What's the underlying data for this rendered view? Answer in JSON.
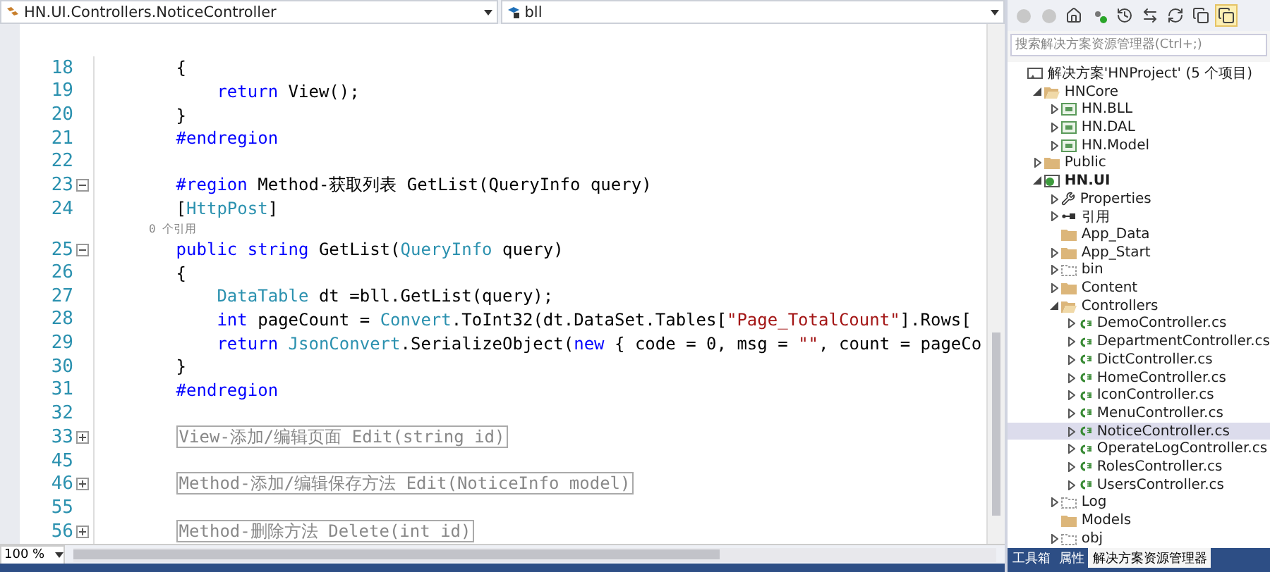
{
  "editor": {
    "type_dropdown": "HN.UI.Controllers.NoticeController",
    "member_dropdown": "bll",
    "lines": [
      {
        "kind": "line",
        "number": "18",
        "tokens": [
          {
            "kind": "plain",
            "text": "{"
          }
        ],
        "children": [
          {
            "kind": "line",
            "number": "19",
            "tokens": [
              {
                "kind": "keyword",
                "text": "return"
              },
              {
                "kind": "plain",
                "text": " View();"
              }
            ]
          }
        ]
      },
      {
        "kind": "line",
        "number": "20",
        "tokens": [
          {
            "kind": "plain",
            "text": "}"
          }
        ]
      },
      {
        "kind": "line",
        "number": "21",
        "tokens": [
          {
            "kind": "keyword",
            "text": "#endregion"
          }
        ]
      },
      {
        "kind": "line",
        "number": "22"
      },
      {
        "kind": "fold-open",
        "number": "23",
        "tokens": [
          {
            "kind": "keyword",
            "text": "#region"
          },
          {
            "kind": "plain",
            "text": " Method-获取列表 GetList(QueryInfo query)"
          }
        ]
      },
      {
        "kind": "line",
        "number": "24",
        "tokens": [
          {
            "kind": "plain",
            "text": "["
          },
          {
            "kind": "type",
            "text": "HttpPost"
          },
          {
            "kind": "plain",
            "text": "]"
          }
        ]
      },
      {
        "kind": "lens",
        "text": "0 个引用"
      },
      {
        "kind": "fold-open",
        "number": "25",
        "tokens": [
          {
            "kind": "keyword",
            "text": "public string"
          },
          {
            "kind": "plain",
            "text": " GetList("
          },
          {
            "kind": "type",
            "text": "QueryInfo"
          },
          {
            "kind": "plain",
            "text": " query)"
          }
        ]
      },
      {
        "kind": "line",
        "number": "26",
        "tokens": [
          {
            "kind": "plain",
            "text": "{"
          }
        ],
        "children": [
          {
            "kind": "line",
            "number": "27",
            "tokens": [
              {
                "kind": "type",
                "text": "DataTable"
              },
              {
                "kind": "plain",
                "text": " dt =bll.GetList(query);"
              }
            ]
          },
          {
            "kind": "line",
            "number": "28",
            "tokens": [
              {
                "kind": "keyword",
                "text": "int"
              },
              {
                "kind": "plain",
                "text": " pageCount = "
              },
              {
                "kind": "type",
                "text": "Convert"
              },
              {
                "kind": "plain",
                "text": ".ToInt32(dt.DataSet.Tables["
              },
              {
                "kind": "string",
                "text": "\"Page_TotalCount\""
              },
              {
                "kind": "plain",
                "text": "].Rows["
              }
            ]
          },
          {
            "kind": "line",
            "number": "29",
            "tokens": [
              {
                "kind": "keyword",
                "text": "return"
              },
              {
                "kind": "type",
                "text": " JsonConvert"
              },
              {
                "kind": "plain",
                "text": ".SerializeObject("
              },
              {
                "kind": "keyword",
                "text": "new"
              },
              {
                "kind": "plain",
                "text": " { code = 0, msg = "
              },
              {
                "kind": "string",
                "text": "\"\""
              },
              {
                "kind": "plain",
                "text": ", count = pageCo"
              }
            ]
          }
        ]
      },
      {
        "kind": "line",
        "number": "30",
        "tokens": [
          {
            "kind": "plain",
            "text": "}"
          }
        ]
      },
      {
        "kind": "line",
        "number": "31",
        "tokens": [
          {
            "kind": "keyword",
            "text": "#endregion"
          }
        ]
      },
      {
        "kind": "line",
        "number": "32"
      },
      {
        "kind": "fold-closed",
        "number": "33",
        "tokens": [
          {
            "kind": "collapsed",
            "text": "View-添加/编辑页面 Edit(string id)"
          }
        ]
      },
      {
        "kind": "line",
        "number": "45"
      },
      {
        "kind": "fold-closed",
        "number": "46",
        "tokens": [
          {
            "kind": "collapsed",
            "text": "Method-添加/编辑保存方法 Edit(NoticeInfo model)"
          }
        ]
      },
      {
        "kind": "line",
        "number": "55"
      },
      {
        "kind": "fold-closed",
        "number": "56",
        "tokens": [
          {
            "kind": "collapsed",
            "text": "Method-删除方法 Delete(int id)"
          }
        ]
      }
    ],
    "zoom": "100 %"
  },
  "solution_explorer": {
    "search": {
      "placeholder": "搜索解决方案资源管理器(Ctrl+;)"
    },
    "tree": [
      {
        "label": "解决方案'HNProject' (5 个项目)",
        "kind": "solution",
        "selected": false,
        "children": [
          {
            "label": "HNCore",
            "kind": "folder",
            "expanded": true,
            "selected": false,
            "children": [
              {
                "label": "HN.BLL",
                "kind": "library",
                "expanded": false,
                "selected": false
              },
              {
                "label": "HN.DAL",
                "kind": "library",
                "expanded": false,
                "selected": false
              },
              {
                "label": "HN.Model",
                "kind": "library",
                "expanded": false,
                "selected": false
              }
            ]
          },
          {
            "label": "Public",
            "kind": "folder",
            "expanded": false,
            "selected": false
          },
          {
            "label": "HN.UI",
            "kind": "webproject",
            "expanded": true,
            "selected": false,
            "children": [
              {
                "label": "Properties",
                "kind": "properties",
                "expanded": false,
                "selected": false
              },
              {
                "label": "引用",
                "kind": "references",
                "expanded": false,
                "selected": false
              },
              {
                "label": "App_Data",
                "kind": "folder",
                "selected": false
              },
              {
                "label": "App_Start",
                "kind": "folder",
                "expanded": false,
                "selected": false
              },
              {
                "label": "bin",
                "kind": "hidden-folder",
                "expanded": false,
                "selected": false
              },
              {
                "label": "Content",
                "kind": "folder",
                "expanded": false,
                "selected": false
              },
              {
                "label": "Controllers",
                "kind": "folder",
                "expanded": true,
                "selected": false,
                "children": [
                  {
                    "label": "DemoController.cs",
                    "kind": "csharp",
                    "expanded": false,
                    "selected": false
                  },
                  {
                    "label": "DepartmentController.cs",
                    "kind": "csharp",
                    "expanded": false,
                    "selected": false
                  },
                  {
                    "label": "DictController.cs",
                    "kind": "csharp",
                    "expanded": false,
                    "selected": false
                  },
                  {
                    "label": "HomeController.cs",
                    "kind": "csharp",
                    "expanded": false,
                    "selected": false
                  },
                  {
                    "label": "IconController.cs",
                    "kind": "csharp",
                    "expanded": false,
                    "selected": false
                  },
                  {
                    "label": "MenuController.cs",
                    "kind": "csharp",
                    "expanded": false,
                    "selected": false
                  },
                  {
                    "label": "NoticeController.cs",
                    "kind": "csharp",
                    "expanded": false,
                    "selected": true
                  },
                  {
                    "label": "OperateLogController.cs",
                    "kind": "csharp",
                    "expanded": false,
                    "selected": false
                  },
                  {
                    "label": "RolesController.cs",
                    "kind": "csharp",
                    "expanded": false,
                    "selected": false
                  },
                  {
                    "label": "UsersController.cs",
                    "kind": "csharp",
                    "expanded": false,
                    "selected": false
                  }
                ]
              },
              {
                "label": "Log",
                "kind": "hidden-folder",
                "expanded": false,
                "selected": false
              },
              {
                "label": "Models",
                "kind": "folder",
                "selected": false
              },
              {
                "label": "obj",
                "kind": "hidden-folder",
                "expanded": false,
                "selected": false
              }
            ]
          }
        ]
      }
    ],
    "tabs": [
      {
        "label": "工具箱",
        "selected": false
      },
      {
        "label": "属性",
        "selected": false
      },
      {
        "label": "解决方案资源管理器",
        "selected": true
      }
    ]
  }
}
